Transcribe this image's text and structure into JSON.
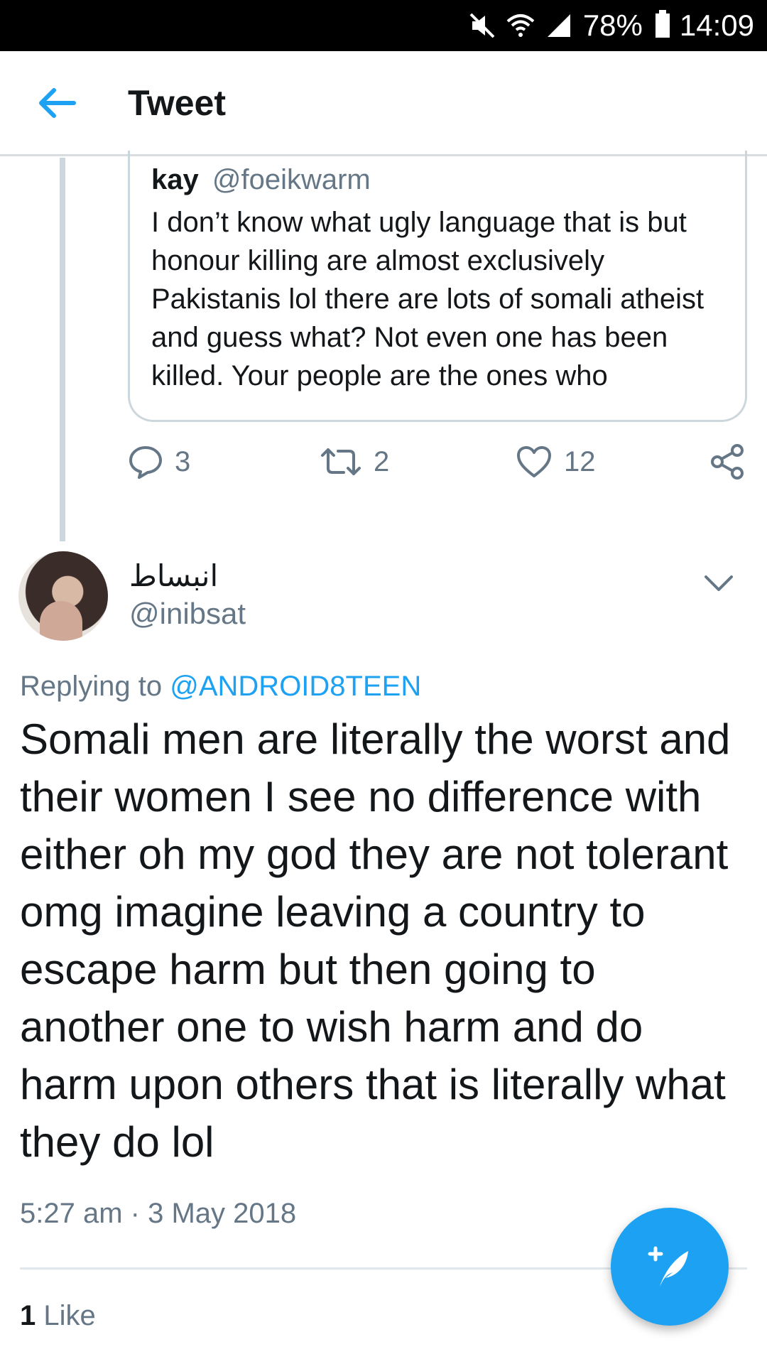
{
  "status_bar": {
    "battery": "78%",
    "time": "14:09",
    "icons": [
      "mute-icon",
      "wifi-icon",
      "signal-icon",
      "battery-icon"
    ]
  },
  "header": {
    "title": "Tweet",
    "back_icon": "back-arrow-icon"
  },
  "quoted_tweet": {
    "name": "kay",
    "handle": "@foeikwarm",
    "text": "I don’t know what ugly language that is but honour killing are almost exclusively Pakistanis lol there are lots of somali atheist and guess what? Not even one has been killed. Your people are the ones who"
  },
  "actions": {
    "replies": "3",
    "retweets": "2",
    "likes": "12"
  },
  "tweet": {
    "author_name": "انبساط",
    "author_handle": "@inibsat",
    "replying_prefix": "Replying to",
    "replying_to": "@ANDROID8TEEN",
    "text": "Somali men are literally the worst and their women I see no difference with either oh my god they are not tolerant omg imagine leaving a country to escape harm but then going to another one to wish harm and do harm upon others that is literally what they do lol",
    "timestamp": "5:27 am · 3 May 2018",
    "like_count": "1",
    "like_label": "Like"
  },
  "colors": {
    "accent": "#1da1f2",
    "secondary_text": "#657786",
    "primary_text": "#14171a",
    "border": "#ccd6dd"
  }
}
